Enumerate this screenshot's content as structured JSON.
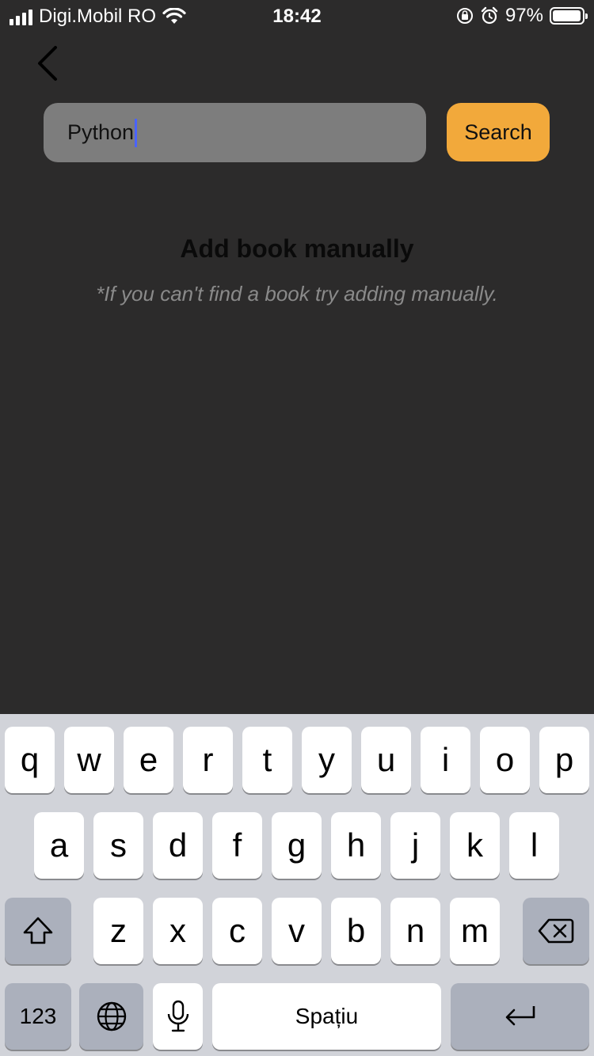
{
  "status_bar": {
    "carrier": "Digi.Mobil RO",
    "time": "18:42",
    "battery": "97%",
    "battery_fill": 0.97
  },
  "search": {
    "value": "Python",
    "button_label": "Search"
  },
  "content": {
    "heading": "Add book manually",
    "hint": "*If you can't find a book try adding manually."
  },
  "keyboard": {
    "row1": [
      "q",
      "w",
      "e",
      "r",
      "t",
      "y",
      "u",
      "i",
      "o",
      "p"
    ],
    "row2": [
      "a",
      "s",
      "d",
      "f",
      "g",
      "h",
      "j",
      "k",
      "l"
    ],
    "row3": [
      "z",
      "x",
      "c",
      "v",
      "b",
      "n",
      "m"
    ],
    "numbers_label": "123",
    "space_label": "Spațiu"
  },
  "icons": {
    "back": "chevron-left-icon",
    "shift": "shift-icon",
    "delete": "backspace-icon",
    "globe": "globe-icon",
    "mic": "microphone-icon",
    "return": "return-icon"
  }
}
